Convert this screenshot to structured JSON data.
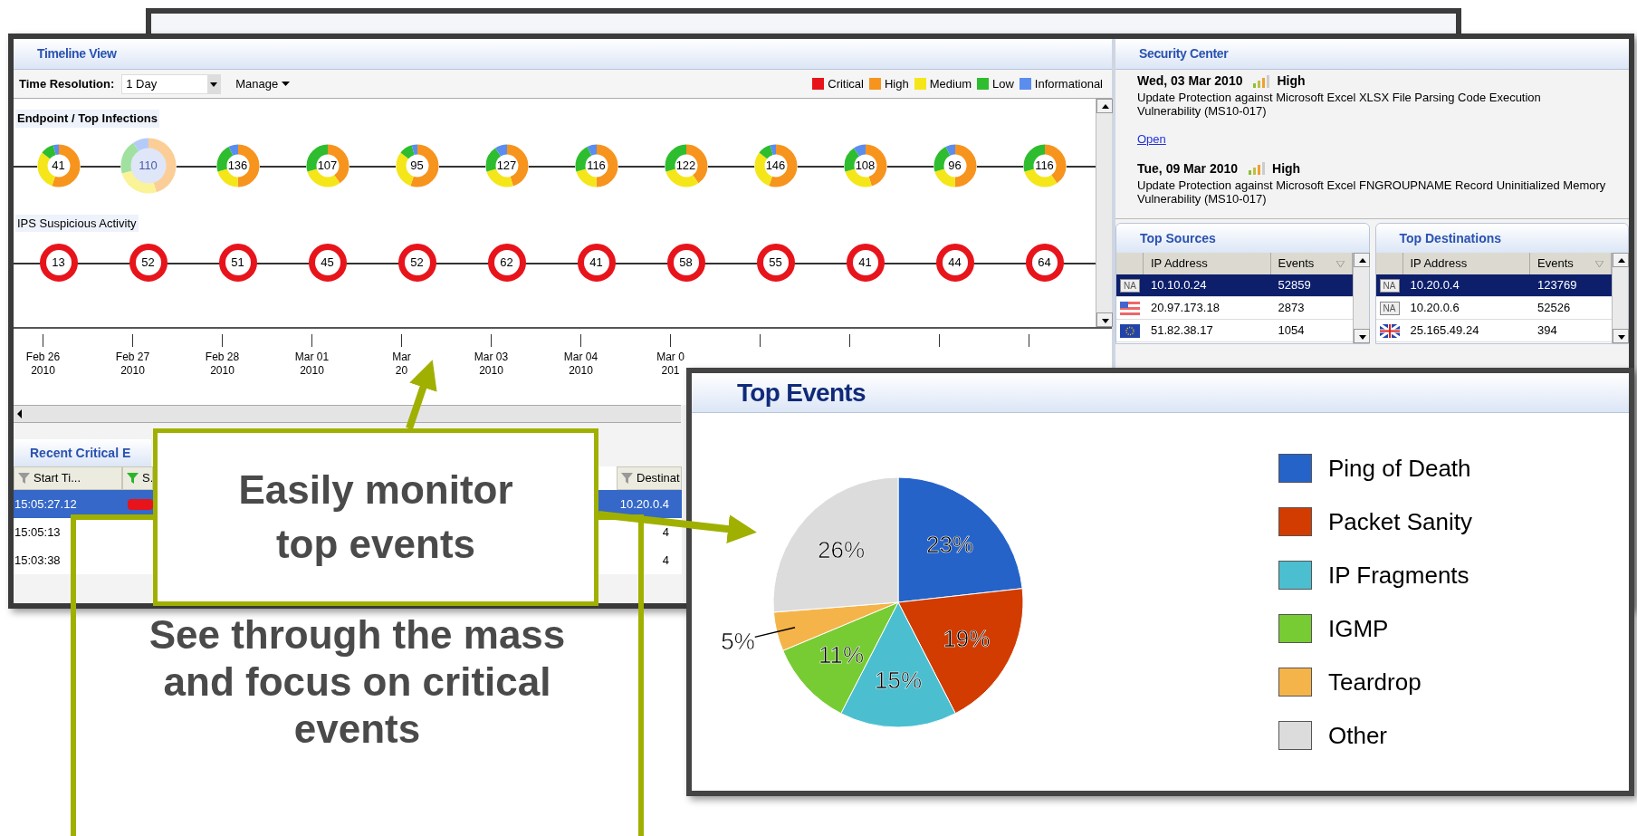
{
  "timeline": {
    "title": "Timeline View",
    "resolution_label": "Time Resolution:",
    "resolution_value": "1 Day",
    "manage_menu": "Manage",
    "legend": [
      {
        "label": "Critical",
        "color": "#e8141b"
      },
      {
        "label": "High",
        "color": "#f7941d"
      },
      {
        "label": "Medium",
        "color": "#f5e61a"
      },
      {
        "label": "Low",
        "color": "#2ebd2e"
      },
      {
        "label": "Informational",
        "color": "#5b8def"
      }
    ],
    "tracks": [
      {
        "kind": "donut",
        "label": "Endpoint / Top Infections",
        "points": [
          {
            "value": "41",
            "selected": false
          },
          {
            "value": "110",
            "selected": true
          },
          {
            "value": "136",
            "selected": false
          },
          {
            "value": "107",
            "selected": false
          },
          {
            "value": "95",
            "selected": false
          },
          {
            "value": "127",
            "selected": false
          },
          {
            "value": "116",
            "selected": false
          },
          {
            "value": "122",
            "selected": false
          },
          {
            "value": "146",
            "selected": false
          },
          {
            "value": "108",
            "selected": false
          },
          {
            "value": "96",
            "selected": false
          },
          {
            "value": "116",
            "selected": false
          }
        ]
      },
      {
        "kind": "ring",
        "label": "IPS Suspicious Activity",
        "points": [
          {
            "value": "13"
          },
          {
            "value": "52"
          },
          {
            "value": "51"
          },
          {
            "value": "45"
          },
          {
            "value": "52"
          },
          {
            "value": "62"
          },
          {
            "value": "41"
          },
          {
            "value": "58"
          },
          {
            "value": "55"
          },
          {
            "value": "41"
          },
          {
            "value": "44"
          },
          {
            "value": "64"
          }
        ]
      }
    ],
    "dates": [
      {
        "day": "Feb 26",
        "year": "2010"
      },
      {
        "day": "Feb 27",
        "year": "2010"
      },
      {
        "day": "Feb 28",
        "year": "2010"
      },
      {
        "day": "Mar 01",
        "year": "2010"
      },
      {
        "day": "Mar",
        "year": "20"
      },
      {
        "day": "Mar 03",
        "year": "2010"
      },
      {
        "day": "Mar 04",
        "year": "2010"
      },
      {
        "day": "Mar 0",
        "year": "201"
      }
    ]
  },
  "recent": {
    "title": "Recent Critical E",
    "columns": [
      {
        "label": "Start Ti...",
        "filtered": false
      },
      {
        "label": "S.",
        "filtered": true
      },
      {
        "label": "Destinat",
        "filtered": false
      }
    ],
    "rows": [
      {
        "time": "15:05:27.12",
        "destination": "10.20.0.4",
        "selected": true
      },
      {
        "time": "15:05:13",
        "destination": "4",
        "selected": false
      },
      {
        "time": "15:03:38",
        "destination": "4",
        "selected": false
      }
    ]
  },
  "security_center": {
    "title": "Security Center",
    "entries": [
      {
        "date": "Wed, 03 Mar 2010",
        "severity": "High",
        "text": "Update Protection against Microsoft Excel XLSX File Parsing Code Execution Vulnerability (MS10-017)",
        "link": "Open"
      },
      {
        "date": "Tue, 09 Mar 2010",
        "severity": "High",
        "text": "Update Protection against Microsoft Excel FNGROUPNAME Record Uninitialized Memory Vulnerability (MS10-017)"
      }
    ]
  },
  "tables": [
    {
      "title": "Top Sources",
      "columns": [
        "IP Address",
        "Events"
      ],
      "rows": [
        {
          "kind": "text",
          "flag": "NA",
          "ip": "10.10.0.24",
          "events": "52859",
          "selected": true
        },
        {
          "kind": "us",
          "ip": "20.97.173.18",
          "events": "2873",
          "selected": false
        },
        {
          "kind": "eu",
          "ip": "51.82.38.17",
          "events": "1054",
          "selected": false
        }
      ]
    },
    {
      "title": "Top Destinations",
      "columns": [
        "IP Address",
        "Events"
      ],
      "rows": [
        {
          "kind": "text",
          "flag": "NA",
          "ip": "10.20.0.4",
          "events": "123769",
          "selected": true
        },
        {
          "kind": "text",
          "flag": "NA",
          "ip": "10.20.0.6",
          "events": "52526",
          "selected": false
        },
        {
          "kind": "uk",
          "ip": "25.165.49.24",
          "events": "394",
          "selected": false
        }
      ]
    }
  ],
  "top_events": {
    "chart_data": {
      "type": "pie",
      "title": "Top Events",
      "categories": [
        "Ping of Death",
        "Packet Sanity",
        "IP Fragments",
        "IGMP",
        "Teardrop",
        "Other"
      ],
      "values": [
        23,
        19,
        15,
        11,
        5,
        26
      ],
      "colors": [
        "#2563c9",
        "#d23c00",
        "#4bbfd0",
        "#77cc33",
        "#f5b44a",
        "#dcdcdc"
      ],
      "value_labels": [
        "23%",
        "19%",
        "15%",
        "11%",
        "5%",
        "26%"
      ]
    }
  },
  "callouts": [
    {
      "text": "Easily monitor top events"
    },
    {
      "text": "See through the mass and focus on critical events"
    }
  ]
}
